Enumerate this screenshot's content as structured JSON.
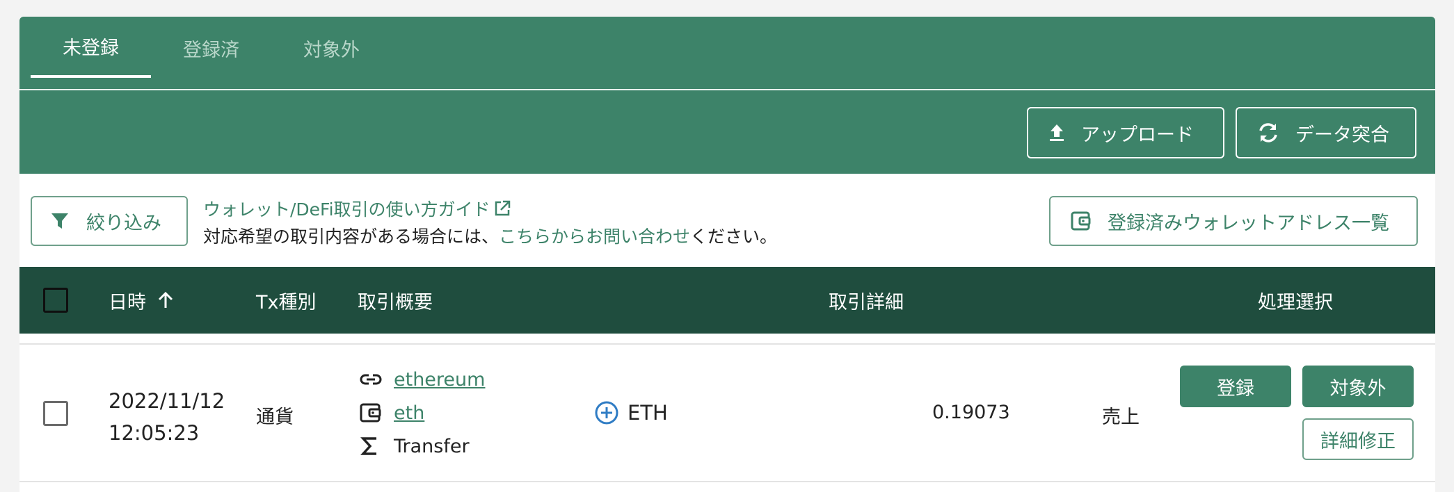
{
  "tabs": [
    {
      "label": "未登録",
      "active": true
    },
    {
      "label": "登録済",
      "active": false
    },
    {
      "label": "対象外",
      "active": false
    }
  ],
  "toolbar": {
    "upload_label": "アップロード",
    "sync_label": "データ突合"
  },
  "filter": {
    "filter_label": "絞り込み",
    "guide_link": "ウォレット/DeFi取引の使い方ガイド",
    "note_prefix": "対応希望の取引内容がある場合には、",
    "note_link": "こちらからお問い合わせ",
    "note_suffix": "ください。",
    "wallet_list_label": "登録済みウォレットアドレス一覧"
  },
  "table": {
    "headers": {
      "datetime": "日時",
      "tx_type": "Tx種別",
      "summary": "取引概要",
      "detail": "取引詳細",
      "action": "処理選択"
    },
    "rows": [
      {
        "date": "2022/11/12",
        "time": "12:05:23",
        "tx_type": "通貨",
        "chain": "ethereum",
        "wallet": "eth",
        "operation": "Transfer",
        "coin": "ETH",
        "amount": "0.19073",
        "side": "売上",
        "actions": {
          "register": "登録",
          "exclude": "対象外",
          "edit": "詳細修正"
        }
      }
    ]
  },
  "colors": {
    "primary": "#3d8369",
    "header_dark": "#1f4d3e",
    "plus_icon": "#2f7cc4"
  }
}
